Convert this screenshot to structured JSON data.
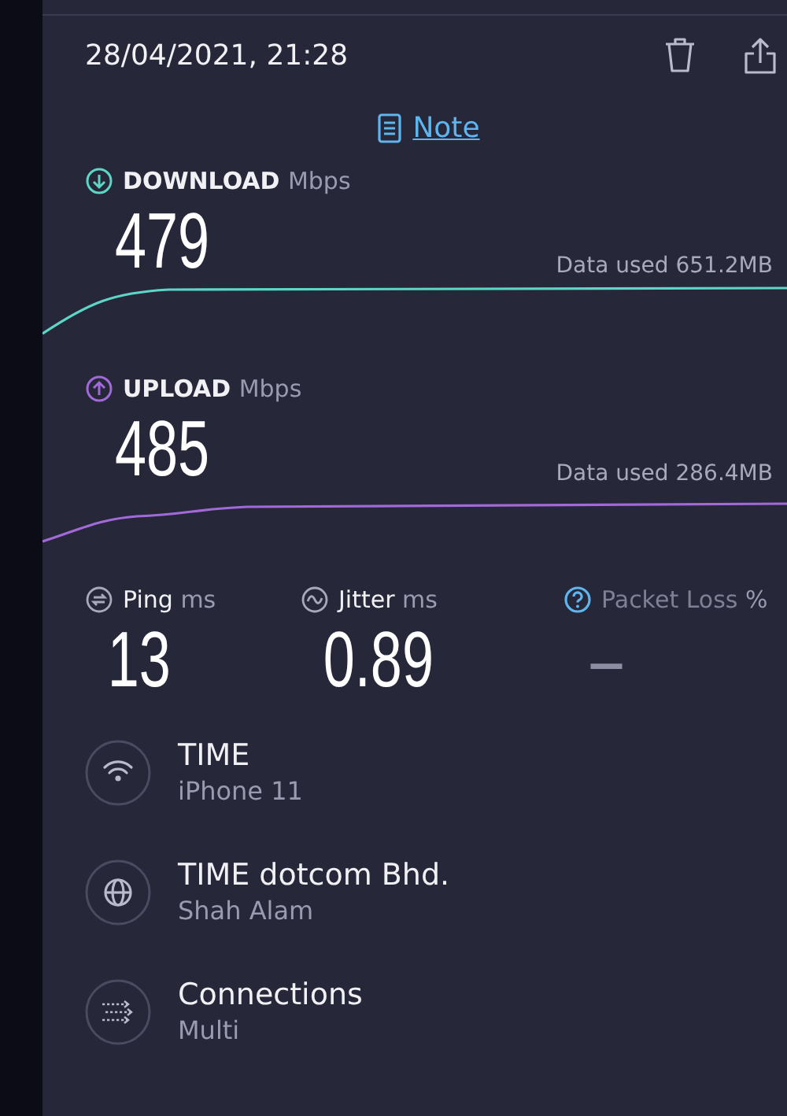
{
  "header": {
    "datetime": "28/04/2021, 21:28"
  },
  "note": {
    "label": "Note"
  },
  "speeds": [
    {
      "kind": "download",
      "label": "DOWNLOAD",
      "unit": "Mbps",
      "value": "479",
      "data_used": "Data used 651.2MB"
    },
    {
      "kind": "upload",
      "label": "UPLOAD",
      "unit": "Mbps",
      "value": "485",
      "data_used": "Data used 286.4MB"
    }
  ],
  "metrics": [
    {
      "kind": "ping",
      "label": "Ping",
      "unit": "ms",
      "value": "13"
    },
    {
      "kind": "jitter",
      "label": "Jitter",
      "unit": "ms",
      "value": "0.89"
    },
    {
      "kind": "loss",
      "label": "Packet Loss",
      "unit": "%",
      "value": "–"
    }
  ],
  "details": [
    {
      "kind": "wifi",
      "title": "TIME",
      "subtitle": "iPhone 11"
    },
    {
      "kind": "globe",
      "title": "TIME dotcom Bhd.",
      "subtitle": "Shah Alam"
    },
    {
      "kind": "connections",
      "title": "Connections",
      "subtitle": "Multi"
    }
  ]
}
